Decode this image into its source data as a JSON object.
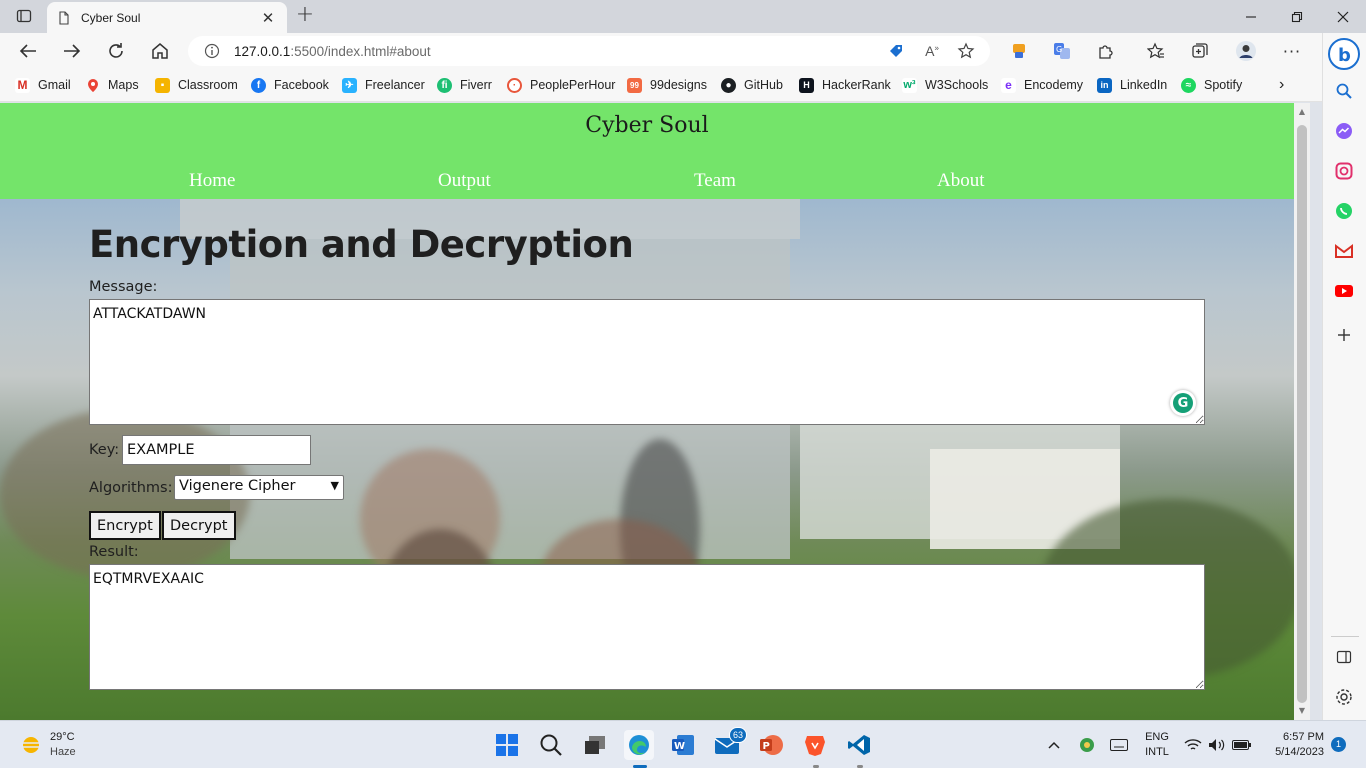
{
  "browser": {
    "tab_title": "Cyber Soul",
    "url_host": "127.0.0.1",
    "url_rest": ":5500/index.html#about",
    "bookmarks": [
      "Gmail",
      "Maps",
      "Classroom",
      "Facebook",
      "Freelancer",
      "Fiverr",
      "PeoplePerHour",
      "99designs",
      "GitHub",
      "HackerRank",
      "W3Schools",
      "Encodemy",
      "LinkedIn",
      "Spotify"
    ]
  },
  "site": {
    "title": "Cyber Soul",
    "nav": [
      "Home",
      "Output",
      "Team",
      "About"
    ]
  },
  "form": {
    "heading": "Encryption and Decryption",
    "message_label": "Message:",
    "message_value": "ATTACKATDAWN",
    "key_label": "Key:",
    "key_value": "EXAMPLE",
    "algorithms_label": "Algorithms:",
    "algorithm_selected": "Vigenere Cipher",
    "encrypt_label": "Encrypt",
    "decrypt_label": "Decrypt",
    "result_label": "Result:",
    "result_value": "EQTMRVEXAAIC"
  },
  "taskbar": {
    "temperature": "29°C",
    "weather": "Haze",
    "mail_badge": "63",
    "lang_top": "ENG",
    "lang_bottom": "INTL",
    "time": "6:57 PM",
    "date": "5/14/2023",
    "notification_count": "1"
  },
  "colors": {
    "header_green": "#74e46a",
    "accent_blue": "#0f6cbd"
  }
}
